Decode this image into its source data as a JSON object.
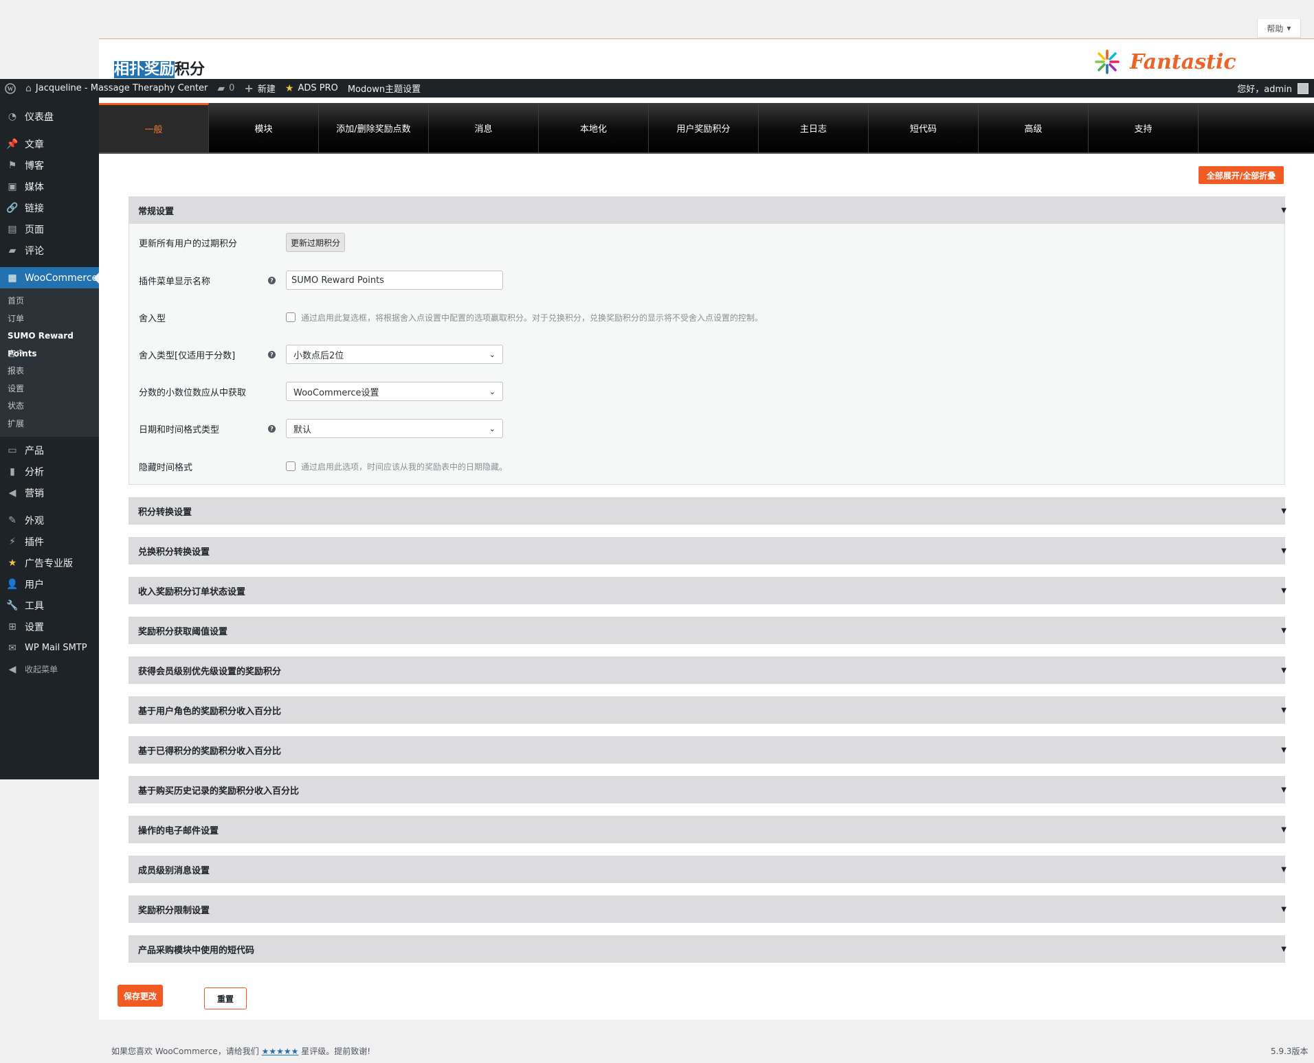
{
  "help": {
    "label": "帮助",
    "caret": "▼"
  },
  "header": {
    "title_highlighted": "相扑奖励",
    "title_rest": "积分",
    "brand": "Fantastic"
  },
  "adminbar": {
    "wp_icon": "wordpress-icon",
    "site_name": "Jacqueline - Massage Theraphy Center",
    "comments_count": "0",
    "new_label": "新建",
    "ads_label": "ADS PRO",
    "modown_label": "Modown主题设置",
    "greeting": "您好，admin"
  },
  "sidebar": {
    "top_items": [
      {
        "label": "仪表盘",
        "icon": "dashboard-icon",
        "glyph": "◔"
      }
    ],
    "group1": [
      {
        "label": "文章",
        "icon": "pin-icon",
        "glyph": "📌"
      },
      {
        "label": "博客",
        "icon": "flag-icon",
        "glyph": "⚑"
      },
      {
        "label": "媒体",
        "icon": "media-icon",
        "glyph": "▣"
      },
      {
        "label": "链接",
        "icon": "link-icon",
        "glyph": "🔗"
      },
      {
        "label": "页面",
        "icon": "page-icon",
        "glyph": "▤"
      },
      {
        "label": "评论",
        "icon": "comment-icon",
        "glyph": "▰"
      }
    ],
    "woocommerce": {
      "label": "WooCommerce",
      "icon": "woo-icon",
      "glyph": "▦"
    },
    "woo_submenu": [
      "首页",
      "订单",
      "SUMO Reward Points",
      "客户",
      "报表",
      "设置",
      "状态",
      "扩展"
    ],
    "woo_active_index": 2,
    "group2": [
      {
        "label": "产品",
        "icon": "product-icon",
        "glyph": "▭"
      },
      {
        "label": "分析",
        "icon": "chart-icon",
        "glyph": "▮"
      },
      {
        "label": "营销",
        "icon": "megaphone-icon",
        "glyph": "◀"
      }
    ],
    "group3": [
      {
        "label": "外观",
        "icon": "brush-icon",
        "glyph": "✎"
      },
      {
        "label": "插件",
        "icon": "plugin-icon",
        "glyph": "⚡"
      },
      {
        "label": "广告专业版",
        "icon": "star-icon",
        "glyph": "★"
      },
      {
        "label": "用户",
        "icon": "user-icon",
        "glyph": "👤"
      },
      {
        "label": "工具",
        "icon": "wrench-icon",
        "glyph": "🔧"
      },
      {
        "label": "设置",
        "icon": "settings-icon",
        "glyph": "⊞"
      },
      {
        "label": "WP Mail SMTP",
        "icon": "mail-icon",
        "glyph": "✉"
      },
      {
        "label": "收起菜单",
        "icon": "collapse-icon",
        "glyph": "◀"
      }
    ]
  },
  "tabs": [
    "一般",
    "模块",
    "添加/删除奖励点数",
    "消息",
    "本地化",
    "用户奖励积分",
    "主日志",
    "短代码",
    "高级",
    "支持"
  ],
  "active_tab": 0,
  "toggle_all_label": "全部展开/全部折叠",
  "general": {
    "title": "常规设置",
    "update_expired": {
      "label": "更新所有用户的过期积分",
      "button": "更新过期积分"
    },
    "menu_name": {
      "label": "插件菜单显示名称",
      "value": "SUMO Reward Points"
    },
    "round": {
      "label": "舍入型",
      "desc": "通过启用此复选框，将根据舍入点设置中配置的选项赢取积分。对于兑换积分，兑换奖励积分的显示将不受舍入点设置的控制。"
    },
    "round_type": {
      "label": "舍入类型[仅适用于分数]",
      "value": "小数点后2位"
    },
    "decimal_source": {
      "label": "分数的小数位数应从中获取",
      "value": "WooCommerce设置"
    },
    "date_format": {
      "label": "日期和时间格式类型",
      "value": "默认"
    },
    "hide_time": {
      "label": "隐藏时间格式",
      "desc": "通过启用此选项，时间应该从我的奖励表中的日期隐藏。"
    }
  },
  "sections": [
    "积分转换设置",
    "兑换积分转换设置",
    "收入奖励积分订单状态设置",
    "奖励积分获取阈值设置",
    "获得会员级别优先级设置的奖励积分",
    "基于用户角色的奖励积分收入百分比",
    "基于已得积分的奖励积分收入百分比",
    "基于购买历史记录的奖励积分收入百分比",
    "操作的电子邮件设置",
    "成员级别消息设置",
    "奖励积分限制设置",
    "产品采购模块中使用的短代码"
  ],
  "save_label": "保存更改",
  "reset_label": "重置",
  "footer": {
    "text_before": "如果您喜欢 WooCommerce，请给我们",
    "stars": "★★★★★",
    "text_after": "星评级。提前致谢!",
    "version": "5.9.3版本"
  },
  "colors": {
    "accent": "#f15a22",
    "wp_blue": "#2271b1",
    "sidebar": "#1d2327"
  }
}
